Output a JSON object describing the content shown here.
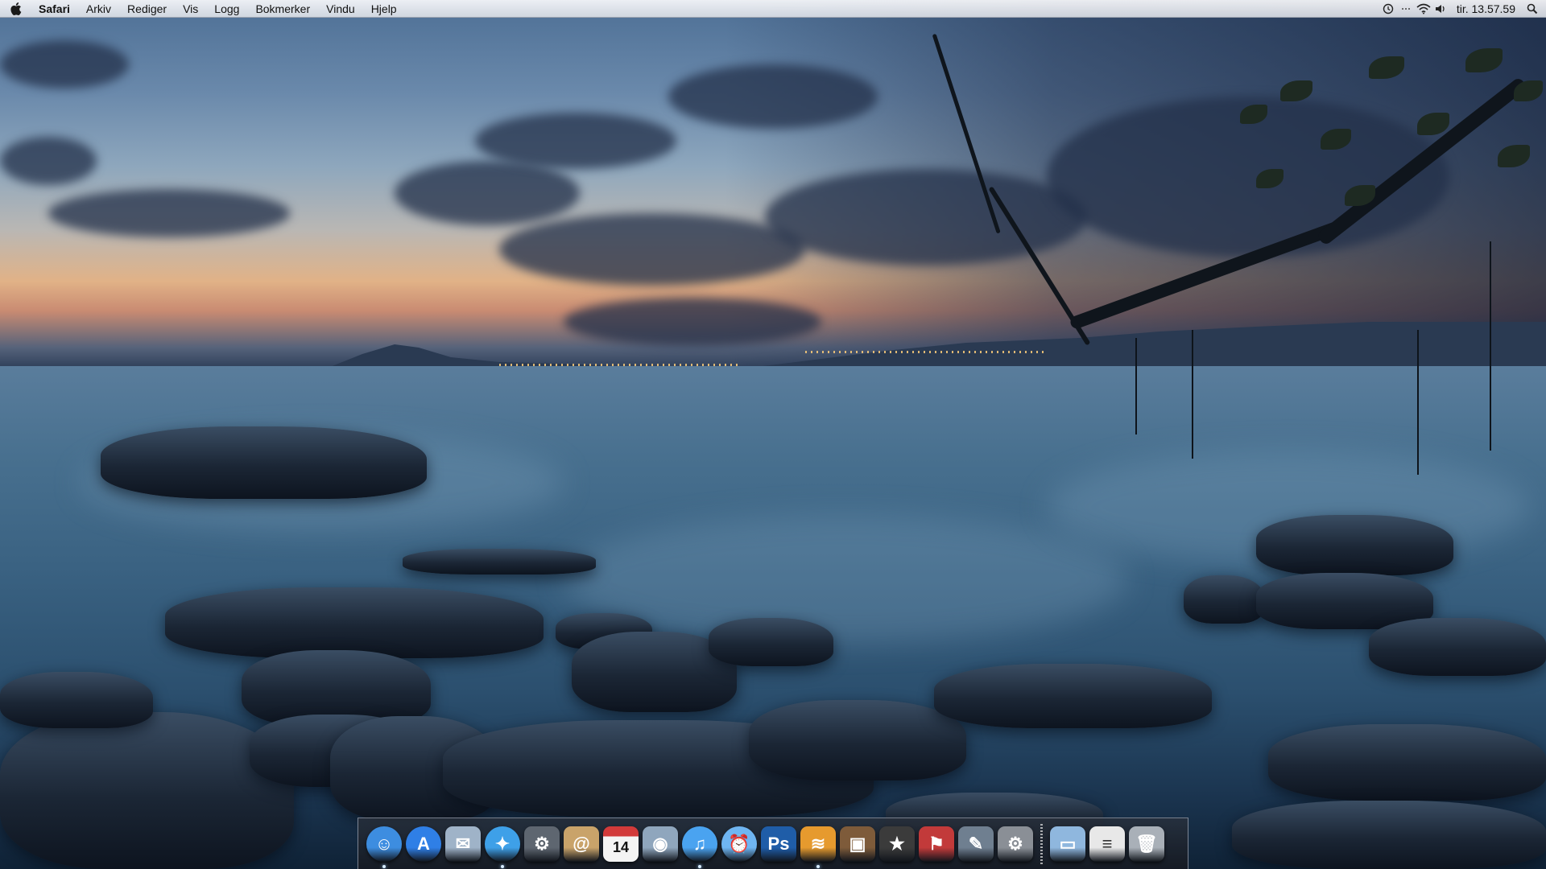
{
  "menubar": {
    "apple_icon": "apple-logo-icon",
    "app_name": "Safari",
    "menus": [
      "Arkiv",
      "Rediger",
      "Vis",
      "Logg",
      "Bokmerker",
      "Vindu",
      "Hjelp"
    ],
    "status_icons": [
      "time-machine-icon",
      "bluetooth-icon",
      "wifi-icon",
      "volume-icon"
    ],
    "clock": "tir. 13.57.59",
    "spotlight_icon": "spotlight-search-icon"
  },
  "dock": {
    "apps": [
      {
        "name": "finder-icon",
        "running": true,
        "color": "#3d8de0",
        "glyph": "☺"
      },
      {
        "name": "app-store-icon",
        "running": false,
        "color": "#2f7fe6",
        "glyph": "A"
      },
      {
        "name": "mail-icon",
        "running": false,
        "color": "#9fb3c8",
        "glyph": "✉"
      },
      {
        "name": "safari-icon",
        "running": true,
        "color": "#3ea0e8",
        "glyph": "✦"
      },
      {
        "name": "steam-icon",
        "running": false,
        "color": "#5e6670",
        "glyph": "⚙"
      },
      {
        "name": "address-book-icon",
        "running": false,
        "color": "#c9a36a",
        "glyph": "@"
      },
      {
        "name": "calendar-icon",
        "running": false,
        "color": "#f2f2f2",
        "glyph": "14"
      },
      {
        "name": "preview-icon",
        "running": false,
        "color": "#8fa6bd",
        "glyph": "◉"
      },
      {
        "name": "itunes-icon",
        "running": true,
        "color": "#4aa3f0",
        "glyph": "♫"
      },
      {
        "name": "alarm-clock-icon",
        "running": false,
        "color": "#6fb5f2",
        "glyph": "⏰"
      },
      {
        "name": "photoshop-icon",
        "running": false,
        "color": "#1f5da8",
        "glyph": "Ps"
      },
      {
        "name": "rss-reader-icon",
        "running": true,
        "color": "#e69a2e",
        "glyph": "≋"
      },
      {
        "name": "iphoto-icon",
        "running": false,
        "color": "#7e5b3a",
        "glyph": "▣"
      },
      {
        "name": "imovie-icon",
        "running": false,
        "color": "#3b3b3b",
        "glyph": "★"
      },
      {
        "name": "automator-icon",
        "running": false,
        "color": "#c23a3a",
        "glyph": "⚑"
      },
      {
        "name": "script-editor-icon",
        "running": false,
        "color": "#6f7f90",
        "glyph": "✎"
      },
      {
        "name": "system-preferences-icon",
        "running": false,
        "color": "#8a8f96",
        "glyph": "⚙"
      }
    ],
    "documents": [
      {
        "name": "documents-folder-icon",
        "color": "#8fb7de",
        "glyph": "▭"
      },
      {
        "name": "downloads-stack-icon",
        "color": "#e8e8e8",
        "glyph": "≡"
      },
      {
        "name": "trash-icon",
        "color": "#a9b0b8",
        "glyph": "🗑"
      }
    ]
  }
}
